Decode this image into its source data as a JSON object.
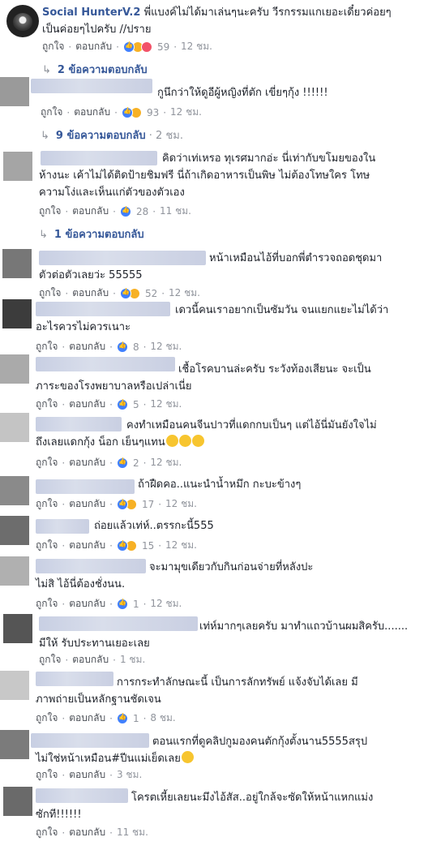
{
  "comments": [
    {
      "author": "Social HunterV.2",
      "text": "พี่แบงค์ไม่ได้มาเล่นๆนะครับ วีรกรรมแกเยอะเดี๋ยวค่อยๆ\nเป็นค่อยๆไปครับ //ปราย",
      "like": "ถูกใจ",
      "reply": "ตอบกลับ",
      "count": "59",
      "time": "12 ชม.",
      "replies": "2 ข้อความตอบกลับ"
    },
    {
      "text": "กูนึกว่าให้ดูอีผู้หญิงที่ตัก เขี่ยๆกุ้ง !!!!!!",
      "like": "ถูกใจ",
      "reply": "ตอบกลับ",
      "count": "93",
      "time": "12 ชม.",
      "replies": "9 ข้อความตอบกลับ",
      "replies_time": "2 ชม."
    },
    {
      "text": "คิดว่าเท่เหรอ ทุเรศมากอ่ะ นี่เท่ากับขโมยของใน\nห้างนะ เค้าไม่ได้ติดป้ายชิมฟรี นี่ถ้าเกิดอาหารเป็นพิษ ไม่ต้องโทษใคร โทษ\nความโง่และเห็นแก่ตัวของตัวเอง",
      "like": "ถูกใจ",
      "reply": "ตอบกลับ",
      "count": "28",
      "time": "11 ชม.",
      "replies": "1 ข้อความตอบกลับ"
    },
    {
      "text": "หน้าเหมือนไอ้ที่บอกพี่ตำรวจถอดชุดมา\nตัวต่อตัวเลยว่ะ 55555",
      "like": "ถูกใจ",
      "reply": "ตอบกลับ",
      "count": "52",
      "time": "12 ชม."
    },
    {
      "text": "เดวนี้คนเราอยากเป็นซัมวัน จนแยกแยะไม่ได้ว่า\nอะไรควรไม่ควรเนาะ",
      "like": "ถูกใจ",
      "reply": "ตอบกลับ",
      "count": "8",
      "time": "12 ชม."
    },
    {
      "text": "เชื้อโรคบานล่ะครับ ระวังท้องเสียนะ จะเป็น\nภาระของโรงพยาบาลหรือเปล่าเนี่ย",
      "like": "ถูกใจ",
      "reply": "ตอบกลับ",
      "count": "5",
      "time": "12 ชม."
    },
    {
      "text": "คงทำเหมือนคนจีนปาวที่แดกกบเป็นๆ แต่ไอ้นี่มันยังใจไม่\nถึงเลยแดกกุ้ง น็อก เย็นๆแทน",
      "like": "ถูกใจ",
      "reply": "ตอบกลับ",
      "count": "2",
      "time": "12 ชม."
    },
    {
      "text": "ถ้าฝืดคอ..แนะนำน้ำหมึก กะบะข้างๆ",
      "like": "ถูกใจ",
      "reply": "ตอบกลับ",
      "count": "17",
      "time": "12 ชม."
    },
    {
      "text": "ถ่อยแล้วเท่ห์..ตรรกะนี้555",
      "like": "ถูกใจ",
      "reply": "ตอบกลับ",
      "count": "15",
      "time": "12 ชม."
    },
    {
      "text": "จะมามุขเดียวกับกินก่อนจ่ายที่หลังปะ\nไม่สิ ไอ้นี่ต้องชั่งนน.",
      "like": "ถูกใจ",
      "reply": "ตอบกลับ",
      "count": "1",
      "time": "12 ชม."
    },
    {
      "text": "เท่ห์มากๆเลยครับ มาทำแถวบ้านผมสิครับ.......\nมีให้ รับประทานเยอะเลย",
      "like": "ถูกใจ",
      "reply": "ตอบกลับ",
      "time": "1 ชม."
    },
    {
      "text": "การกระทำลักษณะนี้ เป็นการลักทรัพย์ แจ้งจับได้เลย มี\nภาพถ่ายเป็นหลักฐานชัดเจน",
      "like": "ถูกใจ",
      "reply": "ตอบกลับ",
      "count": "1",
      "time": "8 ชม."
    },
    {
      "text": "ตอนแรกที่ดูคลิปกูมองคนตักกุ้งตั้งนาน5555สรุป\nไม่ใช่หน้าเหมือน#ปีนแม่เย็ดเลย",
      "like": "ถูกใจ",
      "reply": "ตอบกลับ",
      "time": "3 ชม."
    },
    {
      "text": "โครตเหี้ยเลยนะมึงไอ้สัส..อยู่ใกล้จะซัดให้หน้าแหกแม่ง\nซักที!!!!!!",
      "like": "ถูกใจ",
      "reply": "ตอบกลับ",
      "time": "11 ชม."
    }
  ]
}
